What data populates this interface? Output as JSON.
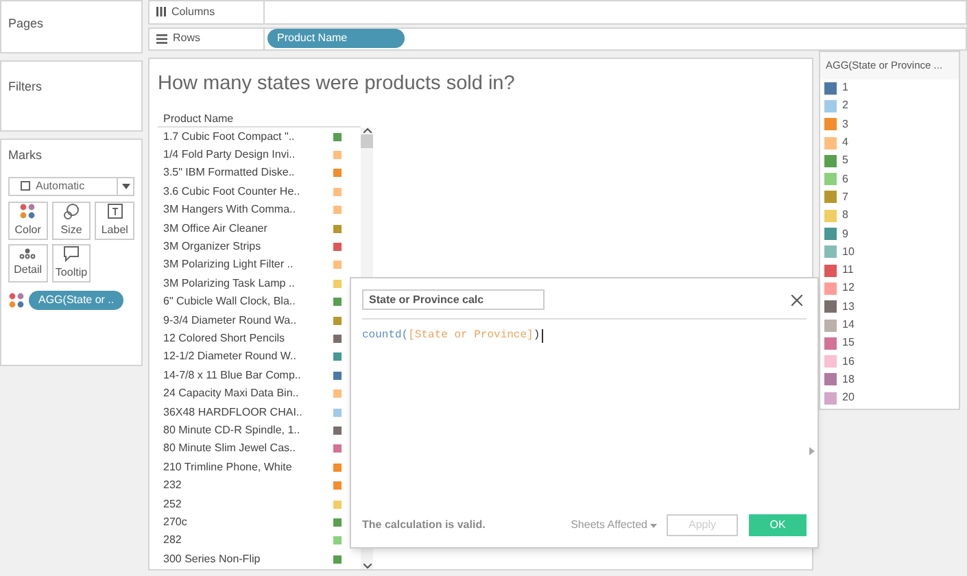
{
  "left_panels": {
    "pages": "Pages",
    "filters": "Filters",
    "marks": {
      "title": "Marks",
      "mark_type": "Automatic",
      "cards": [
        {
          "label": "Color",
          "kind": "color"
        },
        {
          "label": "Size",
          "kind": "size"
        },
        {
          "label": "Label",
          "kind": "label"
        },
        {
          "label": "Detail",
          "kind": "detail"
        },
        {
          "label": "Tooltip",
          "kind": "tooltip"
        }
      ],
      "pill": "AGG(State or .."
    }
  },
  "shelves": {
    "columns": {
      "label": "Columns"
    },
    "rows": {
      "label": "Rows",
      "pills": [
        "Product Name"
      ]
    }
  },
  "view": {
    "title": "How many states were products sold in?",
    "column_header": "Product Name",
    "rows": [
      {
        "name": "1.7 Cubic Foot Compact \"..",
        "color": "#59a14f"
      },
      {
        "name": "1/4 Fold Party Design Invi..",
        "color": "#ffbe7d"
      },
      {
        "name": "3.5\" IBM Formatted Diske..",
        "color": "#f28e2b"
      },
      {
        "name": "3.6 Cubic Foot Counter He..",
        "color": "#ffbe7d"
      },
      {
        "name": "3M Hangers With Comma..",
        "color": "#ffbe7d"
      },
      {
        "name": "3M Office Air Cleaner",
        "color": "#b6992d"
      },
      {
        "name": "3M Organizer Strips",
        "color": "#e15759"
      },
      {
        "name": "3M Polarizing Light Filter ..",
        "color": "#ffbe7d"
      },
      {
        "name": "3M Polarizing Task Lamp ..",
        "color": "#f1ce63"
      },
      {
        "name": "6\" Cubicle Wall Clock, Bla..",
        "color": "#59a14f"
      },
      {
        "name": "9-3/4 Diameter Round Wa..",
        "color": "#b6992d"
      },
      {
        "name": "12 Colored Short Pencils",
        "color": "#79706e"
      },
      {
        "name": "12-1/2 Diameter Round W..",
        "color": "#499894"
      },
      {
        "name": "14-7/8 x 11 Blue Bar Comp..",
        "color": "#4e79a7"
      },
      {
        "name": "24 Capacity Maxi Data Bin..",
        "color": "#ffbe7d"
      },
      {
        "name": "36X48 HARDFLOOR CHAI..",
        "color": "#a0cbe8"
      },
      {
        "name": "80 Minute CD-R Spindle, 1..",
        "color": "#79706e"
      },
      {
        "name": "80 Minute Slim Jewel Cas..",
        "color": "#d37295"
      },
      {
        "name": "210 Trimline Phone, White",
        "color": "#f28e2b"
      },
      {
        "name": "232",
        "color": "#f28e2b"
      },
      {
        "name": "252",
        "color": "#f1ce63"
      },
      {
        "name": "270c",
        "color": "#59a14f"
      },
      {
        "name": "282",
        "color": "#8cd17d"
      },
      {
        "name": "300 Series Non-Flip",
        "color": "#59a14f"
      }
    ]
  },
  "legend": {
    "title": "AGG(State or Province ...",
    "items": [
      {
        "label": "1",
        "color": "#4e79a7"
      },
      {
        "label": "2",
        "color": "#a0cbe8"
      },
      {
        "label": "3",
        "color": "#f28e2b"
      },
      {
        "label": "4",
        "color": "#ffbe7d"
      },
      {
        "label": "5",
        "color": "#59a14f"
      },
      {
        "label": "6",
        "color": "#8cd17d"
      },
      {
        "label": "7",
        "color": "#b6992d"
      },
      {
        "label": "8",
        "color": "#f1ce63"
      },
      {
        "label": "9",
        "color": "#499894"
      },
      {
        "label": "10",
        "color": "#86bcb6"
      },
      {
        "label": "11",
        "color": "#e15759"
      },
      {
        "label": "12",
        "color": "#ff9d9a"
      },
      {
        "label": "13",
        "color": "#79706e"
      },
      {
        "label": "14",
        "color": "#bab0ac"
      },
      {
        "label": "15",
        "color": "#d37295"
      },
      {
        "label": "16",
        "color": "#fabfd2"
      },
      {
        "label": "18",
        "color": "#b07aa1"
      },
      {
        "label": "20",
        "color": "#d4a6c8"
      }
    ]
  },
  "calc_dialog": {
    "name": "State or Province calc",
    "code": [
      {
        "text": "countd(",
        "kind": "function"
      },
      {
        "text": "[State or Province]",
        "kind": "field"
      },
      {
        "text": ")",
        "kind": "plain"
      }
    ],
    "status": "The calculation is valid.",
    "sheets_affected": "Sheets Affected",
    "apply": {
      "label": "Apply",
      "disabled": true
    },
    "ok": "OK"
  }
}
